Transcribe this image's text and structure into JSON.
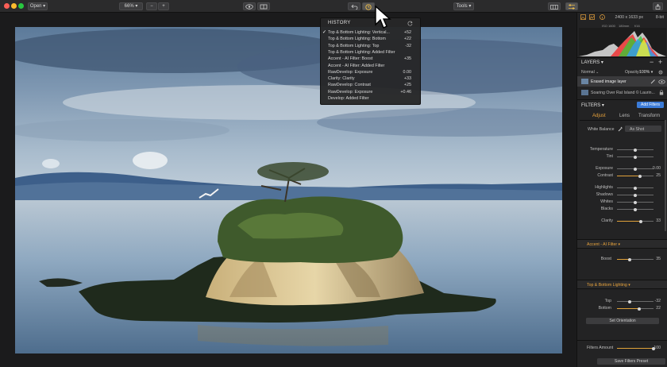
{
  "toolbar": {
    "open_label": "Open ▾",
    "zoom_label": "66% ▾",
    "zoom_minus": "−",
    "zoom_plus": "+",
    "tools_label": "Tools ▾"
  },
  "history": {
    "title": "HISTORY",
    "items": [
      {
        "label": "Top & Bottom Lighting: Vertical...",
        "value": "+52",
        "checked": true
      },
      {
        "label": "Top & Bottom Lighting: Bottom",
        "value": "+22"
      },
      {
        "label": "Top & Bottom Lighting: Top",
        "value": "-32"
      },
      {
        "label": "Top & Bottom Lighting: Added Filter",
        "value": ""
      },
      {
        "label": "Accent - AI Filter: Boost",
        "value": "+35"
      },
      {
        "label": "Accent - AI Filter: Added Filter",
        "value": ""
      },
      {
        "label": "RawDevelop: Exposure",
        "value": "0.00"
      },
      {
        "label": "Clarity: Clarity",
        "value": "+33"
      },
      {
        "label": "RawDevelop: Contrast",
        "value": "+25"
      },
      {
        "label": "RawDevelop: Exposure",
        "value": "+0.46"
      },
      {
        "label": "Develop: Added Filter",
        "value": ""
      }
    ]
  },
  "info": {
    "dimensions": "2400 x 1633 px",
    "bit_depth": "8-bit",
    "iso": "ISO 1600",
    "focal": "180mm",
    "aperture": "f/16"
  },
  "layers": {
    "title": "LAYERS ▾",
    "blend_mode": "Normal ⌄",
    "opacity_label": "Opacity:",
    "opacity_value": "100% ▾",
    "items": [
      {
        "name": "Erased image layer",
        "selected": true
      },
      {
        "name": "Soaring Over Rat Island © Laurin..."
      }
    ]
  },
  "filters": {
    "title": "FILTERS ▾",
    "add_button": "Add Filters",
    "tabs": [
      "Adjust",
      "Lens",
      "Transform"
    ],
    "white_balance_label": "White Balance",
    "white_balance_value": "As Shot",
    "sliders": [
      {
        "label": "Temperature",
        "value": "",
        "pos": 0.5
      },
      {
        "label": "Tint",
        "value": "",
        "pos": 0.5
      },
      {
        "label": "Exposure",
        "value": "0.00",
        "pos": 0.5
      },
      {
        "label": "Contrast",
        "value": "25",
        "pos": 0.62
      },
      {
        "label": "Highlights",
        "value": "",
        "pos": 0.5
      },
      {
        "label": "Shadows",
        "value": "",
        "pos": 0.5
      },
      {
        "label": "Whites",
        "value": "",
        "pos": 0.5
      },
      {
        "label": "Blacks",
        "value": "",
        "pos": 0.5
      },
      {
        "label": "Clarity",
        "value": "33",
        "pos": 0.66
      }
    ],
    "accent_title": "Accent - AI Filter ▾",
    "boost_label": "Boost",
    "boost_value": "35",
    "boost_pos": 0.35,
    "tb_title": "Top & Bottom Lighting ▾",
    "top_label": "Top",
    "top_value": "-32",
    "top_pos": 0.34,
    "bottom_label": "Bottom",
    "bottom_value": "22",
    "bottom_pos": 0.61,
    "orientation_button": "Set Orientation",
    "amount_label": "Filters Amount",
    "amount_value": "100",
    "amount_pos": 1.0,
    "preset_button": "Save Filters Preset"
  },
  "colors": {
    "accent": "#e8a33c",
    "add_button": "#3b7bd8"
  }
}
